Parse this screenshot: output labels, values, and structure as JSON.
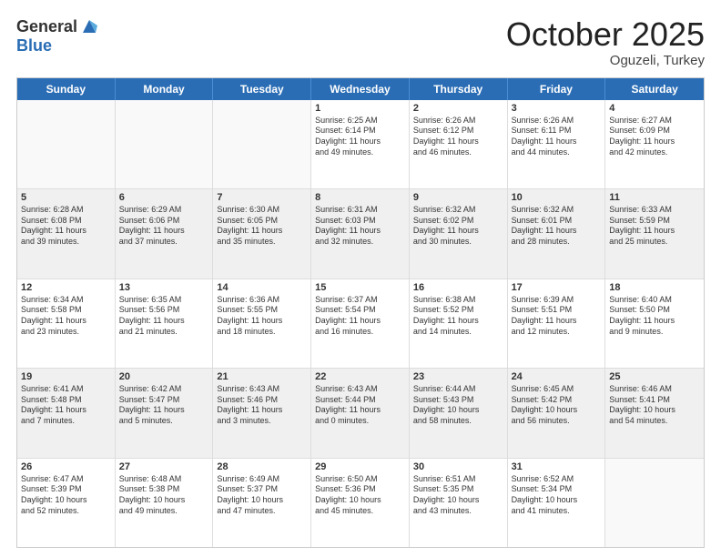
{
  "header": {
    "logo_general": "General",
    "logo_blue": "Blue",
    "month_title": "October 2025",
    "subtitle": "Oguzeli, Turkey"
  },
  "weekdays": [
    "Sunday",
    "Monday",
    "Tuesday",
    "Wednesday",
    "Thursday",
    "Friday",
    "Saturday"
  ],
  "rows": [
    [
      {
        "day": "",
        "lines": []
      },
      {
        "day": "",
        "lines": []
      },
      {
        "day": "",
        "lines": []
      },
      {
        "day": "1",
        "lines": [
          "Sunrise: 6:25 AM",
          "Sunset: 6:14 PM",
          "Daylight: 11 hours",
          "and 49 minutes."
        ]
      },
      {
        "day": "2",
        "lines": [
          "Sunrise: 6:26 AM",
          "Sunset: 6:12 PM",
          "Daylight: 11 hours",
          "and 46 minutes."
        ]
      },
      {
        "day": "3",
        "lines": [
          "Sunrise: 6:26 AM",
          "Sunset: 6:11 PM",
          "Daylight: 11 hours",
          "and 44 minutes."
        ]
      },
      {
        "day": "4",
        "lines": [
          "Sunrise: 6:27 AM",
          "Sunset: 6:09 PM",
          "Daylight: 11 hours",
          "and 42 minutes."
        ]
      }
    ],
    [
      {
        "day": "5",
        "lines": [
          "Sunrise: 6:28 AM",
          "Sunset: 6:08 PM",
          "Daylight: 11 hours",
          "and 39 minutes."
        ]
      },
      {
        "day": "6",
        "lines": [
          "Sunrise: 6:29 AM",
          "Sunset: 6:06 PM",
          "Daylight: 11 hours",
          "and 37 minutes."
        ]
      },
      {
        "day": "7",
        "lines": [
          "Sunrise: 6:30 AM",
          "Sunset: 6:05 PM",
          "Daylight: 11 hours",
          "and 35 minutes."
        ]
      },
      {
        "day": "8",
        "lines": [
          "Sunrise: 6:31 AM",
          "Sunset: 6:03 PM",
          "Daylight: 11 hours",
          "and 32 minutes."
        ]
      },
      {
        "day": "9",
        "lines": [
          "Sunrise: 6:32 AM",
          "Sunset: 6:02 PM",
          "Daylight: 11 hours",
          "and 30 minutes."
        ]
      },
      {
        "day": "10",
        "lines": [
          "Sunrise: 6:32 AM",
          "Sunset: 6:01 PM",
          "Daylight: 11 hours",
          "and 28 minutes."
        ]
      },
      {
        "day": "11",
        "lines": [
          "Sunrise: 6:33 AM",
          "Sunset: 5:59 PM",
          "Daylight: 11 hours",
          "and 25 minutes."
        ]
      }
    ],
    [
      {
        "day": "12",
        "lines": [
          "Sunrise: 6:34 AM",
          "Sunset: 5:58 PM",
          "Daylight: 11 hours",
          "and 23 minutes."
        ]
      },
      {
        "day": "13",
        "lines": [
          "Sunrise: 6:35 AM",
          "Sunset: 5:56 PM",
          "Daylight: 11 hours",
          "and 21 minutes."
        ]
      },
      {
        "day": "14",
        "lines": [
          "Sunrise: 6:36 AM",
          "Sunset: 5:55 PM",
          "Daylight: 11 hours",
          "and 18 minutes."
        ]
      },
      {
        "day": "15",
        "lines": [
          "Sunrise: 6:37 AM",
          "Sunset: 5:54 PM",
          "Daylight: 11 hours",
          "and 16 minutes."
        ]
      },
      {
        "day": "16",
        "lines": [
          "Sunrise: 6:38 AM",
          "Sunset: 5:52 PM",
          "Daylight: 11 hours",
          "and 14 minutes."
        ]
      },
      {
        "day": "17",
        "lines": [
          "Sunrise: 6:39 AM",
          "Sunset: 5:51 PM",
          "Daylight: 11 hours",
          "and 12 minutes."
        ]
      },
      {
        "day": "18",
        "lines": [
          "Sunrise: 6:40 AM",
          "Sunset: 5:50 PM",
          "Daylight: 11 hours",
          "and 9 minutes."
        ]
      }
    ],
    [
      {
        "day": "19",
        "lines": [
          "Sunrise: 6:41 AM",
          "Sunset: 5:48 PM",
          "Daylight: 11 hours",
          "and 7 minutes."
        ]
      },
      {
        "day": "20",
        "lines": [
          "Sunrise: 6:42 AM",
          "Sunset: 5:47 PM",
          "Daylight: 11 hours",
          "and 5 minutes."
        ]
      },
      {
        "day": "21",
        "lines": [
          "Sunrise: 6:43 AM",
          "Sunset: 5:46 PM",
          "Daylight: 11 hours",
          "and 3 minutes."
        ]
      },
      {
        "day": "22",
        "lines": [
          "Sunrise: 6:43 AM",
          "Sunset: 5:44 PM",
          "Daylight: 11 hours",
          "and 0 minutes."
        ]
      },
      {
        "day": "23",
        "lines": [
          "Sunrise: 6:44 AM",
          "Sunset: 5:43 PM",
          "Daylight: 10 hours",
          "and 58 minutes."
        ]
      },
      {
        "day": "24",
        "lines": [
          "Sunrise: 6:45 AM",
          "Sunset: 5:42 PM",
          "Daylight: 10 hours",
          "and 56 minutes."
        ]
      },
      {
        "day": "25",
        "lines": [
          "Sunrise: 6:46 AM",
          "Sunset: 5:41 PM",
          "Daylight: 10 hours",
          "and 54 minutes."
        ]
      }
    ],
    [
      {
        "day": "26",
        "lines": [
          "Sunrise: 6:47 AM",
          "Sunset: 5:39 PM",
          "Daylight: 10 hours",
          "and 52 minutes."
        ]
      },
      {
        "day": "27",
        "lines": [
          "Sunrise: 6:48 AM",
          "Sunset: 5:38 PM",
          "Daylight: 10 hours",
          "and 49 minutes."
        ]
      },
      {
        "day": "28",
        "lines": [
          "Sunrise: 6:49 AM",
          "Sunset: 5:37 PM",
          "Daylight: 10 hours",
          "and 47 minutes."
        ]
      },
      {
        "day": "29",
        "lines": [
          "Sunrise: 6:50 AM",
          "Sunset: 5:36 PM",
          "Daylight: 10 hours",
          "and 45 minutes."
        ]
      },
      {
        "day": "30",
        "lines": [
          "Sunrise: 6:51 AM",
          "Sunset: 5:35 PM",
          "Daylight: 10 hours",
          "and 43 minutes."
        ]
      },
      {
        "day": "31",
        "lines": [
          "Sunrise: 6:52 AM",
          "Sunset: 5:34 PM",
          "Daylight: 10 hours",
          "and 41 minutes."
        ]
      },
      {
        "day": "",
        "lines": []
      }
    ]
  ]
}
